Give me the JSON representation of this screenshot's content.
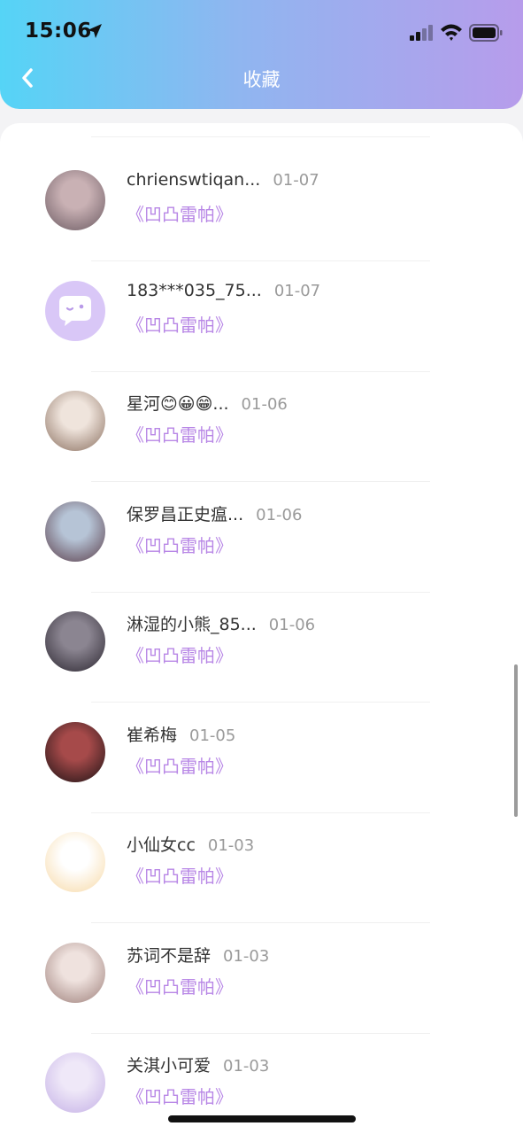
{
  "status_bar": {
    "time": "15:06"
  },
  "header": {
    "title": "收藏"
  },
  "favorites": [
    {
      "name": "chrienswtiqan...",
      "date": "01-07",
      "book": "《凹凸雷帕》",
      "avatar_colors": [
        "#6b5a62",
        "#c9b1b4"
      ]
    },
    {
      "name": "183***035_75...",
      "date": "01-07",
      "book": "《凹凸雷帕》",
      "avatar_colors": [
        "#d9c7f7",
        "#ffffff"
      ]
    },
    {
      "name": "星河😊😀😁...",
      "date": "01-06",
      "book": "《凹凸雷帕》",
      "avatar_colors": [
        "#8a6f5f",
        "#efe4dc"
      ]
    },
    {
      "name": "保罗昌正史瘟...",
      "date": "01-06",
      "book": "《凹凸雷帕》",
      "avatar_colors": [
        "#5a3d4a",
        "#b6c4d6"
      ]
    },
    {
      "name": "淋湿的小熊_85...",
      "date": "01-06",
      "book": "《凹凸雷帕》",
      "avatar_colors": [
        "#2b2630",
        "#8b8591"
      ]
    },
    {
      "name": "崔希梅",
      "date": "01-05",
      "book": "《凹凸雷帕》",
      "avatar_colors": [
        "#1b1214",
        "#a64a4a"
      ]
    },
    {
      "name": "小仙女cc",
      "date": "01-03",
      "book": "《凹凸雷帕》",
      "avatar_colors": [
        "#f7d9a6",
        "#ffffff"
      ]
    },
    {
      "name": "苏词不是辞",
      "date": "01-03",
      "book": "《凹凸雷帕》",
      "avatar_colors": [
        "#9d7f7a",
        "#efe2de"
      ]
    },
    {
      "name": "关淇小可爱",
      "date": "01-03",
      "book": "《凹凸雷帕》",
      "avatar_colors": [
        "#c4b0e6",
        "#efe8f8"
      ]
    }
  ]
}
